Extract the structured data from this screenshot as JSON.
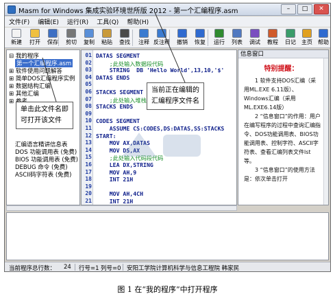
{
  "window": {
    "title": "Masm for Windows 集成实验环境世所版 2012 - 第一个汇编程序.asm",
    "buttons": {
      "minimize": "–",
      "maximize": "□",
      "close": "✕"
    }
  },
  "menu": [
    "文件(F)",
    "编辑(E)",
    "运行(R)",
    "工具(Q)",
    "帮助(H)"
  ],
  "toolbar": [
    {
      "label": "新建",
      "icon": "new-file-icon",
      "color": "#f3f3f3"
    },
    {
      "label": "打开",
      "icon": "open-folder-icon",
      "color": "#f0c040"
    },
    {
      "label": "保存",
      "icon": "save-icon",
      "color": "#3d6fc4"
    },
    {
      "label": "剪切",
      "icon": "cut-icon",
      "color": "#777777"
    },
    {
      "label": "复制",
      "icon": "copy-icon",
      "color": "#5a8fd8"
    },
    {
      "label": "粘贴",
      "icon": "paste-icon",
      "color": "#c99a3a"
    },
    {
      "label": "查找",
      "icon": "find-icon",
      "color": "#4a4a4a"
    },
    {
      "label": "注释",
      "icon": "comment-icon",
      "color": "#3b7bd0"
    },
    {
      "label": "反注释",
      "icon": "uncomment-icon",
      "color": "#3b7bd0"
    },
    {
      "label": "撤销",
      "icon": "undo-icon",
      "color": "#2f6ad0"
    },
    {
      "label": "恢复",
      "icon": "redo-icon",
      "color": "#2f6ad0"
    },
    {
      "label": "运行",
      "icon": "run-icon",
      "color": "#2f8a2f"
    },
    {
      "label": "列表",
      "icon": "list-icon",
      "color": "#5078c0"
    },
    {
      "label": "调试",
      "icon": "debug-icon",
      "color": "#7a4fc0"
    },
    {
      "label": "教程",
      "icon": "tutorial-icon",
      "color": "#d05a2a"
    },
    {
      "label": "日记",
      "icon": "diary-icon",
      "color": "#3a9c6a"
    },
    {
      "label": "主页",
      "icon": "home-icon",
      "color": "#e0a020"
    },
    {
      "label": "帮助",
      "icon": "help-icon",
      "color": "#2f6ad0"
    }
  ],
  "tree": {
    "root": "我的程序",
    "selected": "第一个汇编程序.asm",
    "items": [
      "软件使用问题解答",
      "简单DOS汇编程序实例",
      "数据结构汇编",
      "其他汇编",
      "参考",
      "汇编语言精讲信息表",
      "DOS 功能调用表 (免费)",
      "BIOS 功能调用表 (免费)",
      "DEBUG 命令 (免费)",
      "ASCII码字符表 (免费)"
    ]
  },
  "editor": {
    "lines": [
      {
        "n": "01",
        "text": "DATAS SEGMENT",
        "kind": "code"
      },
      {
        "n": "02",
        "text": "    ;此处输入数据段代码",
        "kind": "cmt"
      },
      {
        "n": "03",
        "text": "    STRING  DB 'Hello World',13,10,'$'",
        "kind": "code"
      },
      {
        "n": "04",
        "text": "DATAS ENDS",
        "kind": "code"
      },
      {
        "n": "05",
        "text": "",
        "kind": "code"
      },
      {
        "n": "06",
        "text": "STACKS SEGMENT",
        "kind": "code"
      },
      {
        "n": "07",
        "text": "    ;此处输入堆栈段代码",
        "kind": "cmt"
      },
      {
        "n": "08",
        "text": "STACKS ENDS",
        "kind": "code"
      },
      {
        "n": "09",
        "text": "",
        "kind": "code"
      },
      {
        "n": "10",
        "text": "CODES SEGMENT",
        "kind": "code"
      },
      {
        "n": "11",
        "text": "    ASSUME CS:CODES,DS:DATAS,SS:STACKS",
        "kind": "code"
      },
      {
        "n": "12",
        "text": "START:",
        "kind": "code"
      },
      {
        "n": "13",
        "text": "    MOV AX,DATAS",
        "kind": "code"
      },
      {
        "n": "14",
        "text": "    MOV DS,AX",
        "kind": "code"
      },
      {
        "n": "15",
        "text": "    ;此处输入代码段代码",
        "kind": "cmt"
      },
      {
        "n": "16",
        "text": "    LEA DX,STRING",
        "kind": "code"
      },
      {
        "n": "17",
        "text": "    MOV AH,9",
        "kind": "code"
      },
      {
        "n": "18",
        "text": "    INT 21H",
        "kind": "code"
      },
      {
        "n": "19",
        "text": "",
        "kind": "code"
      },
      {
        "n": "20",
        "text": "    MOV AH,4CH",
        "kind": "code"
      },
      {
        "n": "21",
        "text": "    INT 21H",
        "kind": "code"
      }
    ]
  },
  "info_panel": {
    "header": "信息窗口",
    "title": "特别提醒：",
    "paragraphs": [
      "1 软件支持DOS汇编（采用ML.EXE 6.11版）、Windows汇编（采用ML.EXE6.14版）",
      "2 “信息窗口”的作用：用户在编写程序的过程中查询汇编指令、DOS功能调用表、BIOS功能调用表、控制字符、ASCII字符表、查看汇编列表文件lst等。",
      "3 “信息窗口”的使用方法是：依次单击打开"
    ]
  },
  "status": {
    "total_lines_label": "当前程序总行数：",
    "total_lines": "24",
    "row": "行号=1",
    "col": "列号=0",
    "author": "安阳工学院计算机科学与信息工程院  韩家民"
  },
  "callouts": {
    "left": [
      "单击此文件名即",
      "可打开该文件"
    ],
    "right": [
      "当前正在编辑的",
      "汇编程序文件名"
    ]
  },
  "caption": "图 1 在“我的程序”中打开程序"
}
